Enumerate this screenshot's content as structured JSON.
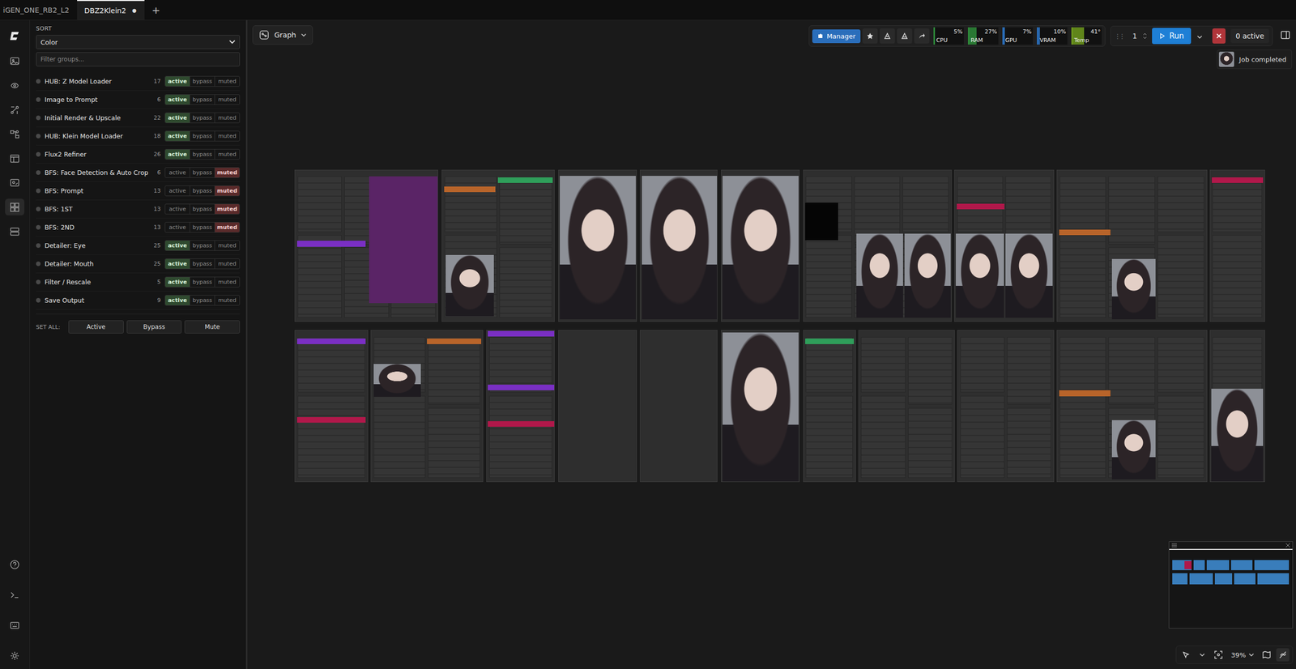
{
  "tabs": [
    {
      "label": "iGEN_ONE_RB2_L2",
      "selected": false
    },
    {
      "label": "DBZ2Klein2",
      "selected": true,
      "dot": "●"
    }
  ],
  "new_tab": "+",
  "panel": {
    "sort_label": "SORT",
    "sort_value": "Color",
    "filter_placeholder": "Filter groups...",
    "groups": [
      {
        "name": "HUB: Z Model Loader",
        "count": "17",
        "buttons": [
          {
            "label": "active",
            "selected": true
          },
          {
            "label": "bypass",
            "selected": false
          },
          {
            "label": "muted",
            "selected": false
          }
        ]
      },
      {
        "name": "Image to Prompt",
        "count": "6",
        "buttons": [
          {
            "label": "active",
            "selected": true
          },
          {
            "label": "bypass",
            "selected": false
          },
          {
            "label": "muted",
            "selected": false
          }
        ]
      },
      {
        "name": "Initial Render & Upscale",
        "count": "22",
        "buttons": [
          {
            "label": "active",
            "selected": true
          },
          {
            "label": "bypass",
            "selected": false
          },
          {
            "label": "muted",
            "selected": false
          }
        ]
      },
      {
        "name": "HUB: Klein Model Loader",
        "count": "18",
        "buttons": [
          {
            "label": "active",
            "selected": true
          },
          {
            "label": "bypass",
            "selected": false
          },
          {
            "label": "muted",
            "selected": false
          }
        ]
      },
      {
        "name": "Flux2 Refiner",
        "count": "26",
        "buttons": [
          {
            "label": "active",
            "selected": true
          },
          {
            "label": "bypass",
            "selected": false
          },
          {
            "label": "muted",
            "selected": false
          }
        ]
      },
      {
        "name": "BFS: Face Detection & Auto Crop",
        "count": "6",
        "buttons": [
          {
            "label": "active",
            "selected": false
          },
          {
            "label": "bypass",
            "selected": false
          },
          {
            "label": "muted",
            "selected": true
          }
        ]
      },
      {
        "name": "BFS: Prompt",
        "count": "13",
        "buttons": [
          {
            "label": "active",
            "selected": false
          },
          {
            "label": "bypass",
            "selected": false
          },
          {
            "label": "muted",
            "selected": true
          }
        ]
      },
      {
        "name": "BFS: 1ST",
        "count": "13",
        "buttons": [
          {
            "label": "active",
            "selected": false
          },
          {
            "label": "bypass",
            "selected": false
          },
          {
            "label": "muted",
            "selected": true
          }
        ]
      },
      {
        "name": "BFS: 2ND",
        "count": "13",
        "buttons": [
          {
            "label": "active",
            "selected": false
          },
          {
            "label": "bypass",
            "selected": false
          },
          {
            "label": "muted",
            "selected": true
          }
        ]
      },
      {
        "name": "Detailer: Eye",
        "count": "25",
        "buttons": [
          {
            "label": "active",
            "selected": true
          },
          {
            "label": "bypass",
            "selected": false
          },
          {
            "label": "muted",
            "selected": false
          }
        ]
      },
      {
        "name": "Detailer: Mouth",
        "count": "25",
        "buttons": [
          {
            "label": "active",
            "selected": true
          },
          {
            "label": "bypass",
            "selected": false
          },
          {
            "label": "muted",
            "selected": false
          }
        ]
      },
      {
        "name": "Filter / Rescale",
        "count": "5",
        "buttons": [
          {
            "label": "active",
            "selected": true
          },
          {
            "label": "bypass",
            "selected": false
          },
          {
            "label": "muted",
            "selected": false
          }
        ]
      },
      {
        "name": "Save Output",
        "count": "9",
        "buttons": [
          {
            "label": "active",
            "selected": true
          },
          {
            "label": "bypass",
            "selected": false
          },
          {
            "label": "muted",
            "selected": false
          }
        ]
      }
    ],
    "set_all_label": "SET ALL:",
    "set_all_buttons": [
      "Active",
      "Bypass",
      "Mute"
    ]
  },
  "canvas": {
    "view_button": "Graph",
    "toolbar": {
      "manager": "Manager",
      "monitors": [
        {
          "label": "CPU",
          "reading": "5%",
          "level": 0.05,
          "color": "#2e8b3a"
        },
        {
          "label": "RAM",
          "reading": "27%",
          "level": 0.27,
          "color": "#2e8b3a"
        },
        {
          "label": "GPU",
          "reading": "7%",
          "level": 0.07,
          "color": "#2a6ebb"
        },
        {
          "label": "VRAM",
          "reading": "10%",
          "level": 0.1,
          "color": "#2a6ebb"
        },
        {
          "label": "Temp",
          "reading": "41°",
          "level": 0.41,
          "color": "#6f9a1c"
        }
      ],
      "queue_count": "1",
      "run": "Run",
      "active": "0 active"
    },
    "toast": "Job completed",
    "zoom": "39%"
  }
}
